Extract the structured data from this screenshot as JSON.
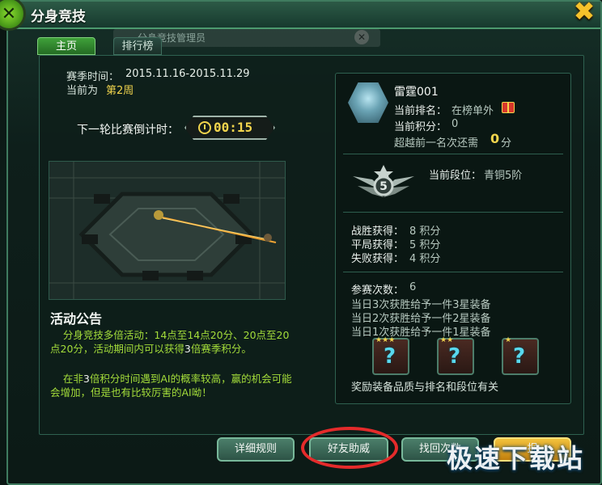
{
  "window": {
    "title": "分身竞技",
    "close_glyph": "✖"
  },
  "ghost": {
    "text": "分身竞技管理员",
    "close_glyph": "✕"
  },
  "tabs": [
    {
      "label": "主页",
      "active": true
    },
    {
      "label": "排行榜",
      "active": false
    }
  ],
  "season": {
    "label": "赛季时间：",
    "value": "2015.11.16-2015.11.29",
    "current_label": "当前为",
    "current_value": "第2周"
  },
  "countdown": {
    "label": "下一轮比赛倒计时：",
    "value": "00:15"
  },
  "notice": {
    "title": "活动公告",
    "p1_a": "分身竞技多倍活动：14点至14点20分、20点至20点20分，活动期间内可以获得",
    "p1_b": "3",
    "p1_c": "倍赛季积分。",
    "p2_a": "在非",
    "p2_b": "3",
    "p2_c": "倍积分时间遇到AI的概率较高，赢的机会可能会增加，但是也有比较厉害的AI呦！"
  },
  "player": {
    "name": "雷霆001",
    "rank_label": "当前排名：",
    "rank_value": "在榜单外",
    "score_label": "当前积分：",
    "score_value": "0",
    "pass_label": "超越前一名次还需",
    "pass_value": "0",
    "pass_unit": "分"
  },
  "tier": {
    "badge_number": "5",
    "label": "当前段位：",
    "value": "青铜5阶"
  },
  "points": [
    {
      "label": "战胜获得：",
      "value": "8 积分"
    },
    {
      "label": "平局获得：",
      "value": "5 积分"
    },
    {
      "label": "失败获得：",
      "value": "4 积分"
    }
  ],
  "participation": {
    "label": "参赛次数：",
    "value": "6",
    "rules": [
      "当日3次获胜给予一件3星装备",
      "当日2次获胜给予一件2星装备",
      "当日1次获胜给予一件1星装备"
    ],
    "tip": "奖励装备品质与排名和段位有关"
  },
  "rewards": [
    {
      "stars": "★★★",
      "glyph": "?"
    },
    {
      "stars": "★★",
      "glyph": "?"
    },
    {
      "stars": "★",
      "glyph": "?"
    }
  ],
  "buttons": {
    "rules": "详细规则",
    "friend": "好友助威",
    "recover": "找回次数",
    "extra": "报"
  },
  "watermark": "极速下载站",
  "colors": {
    "accent_yellow": "#f2d54d",
    "accent_green": "#a3dc3a",
    "highlight_ring": "#e42b2b"
  }
}
